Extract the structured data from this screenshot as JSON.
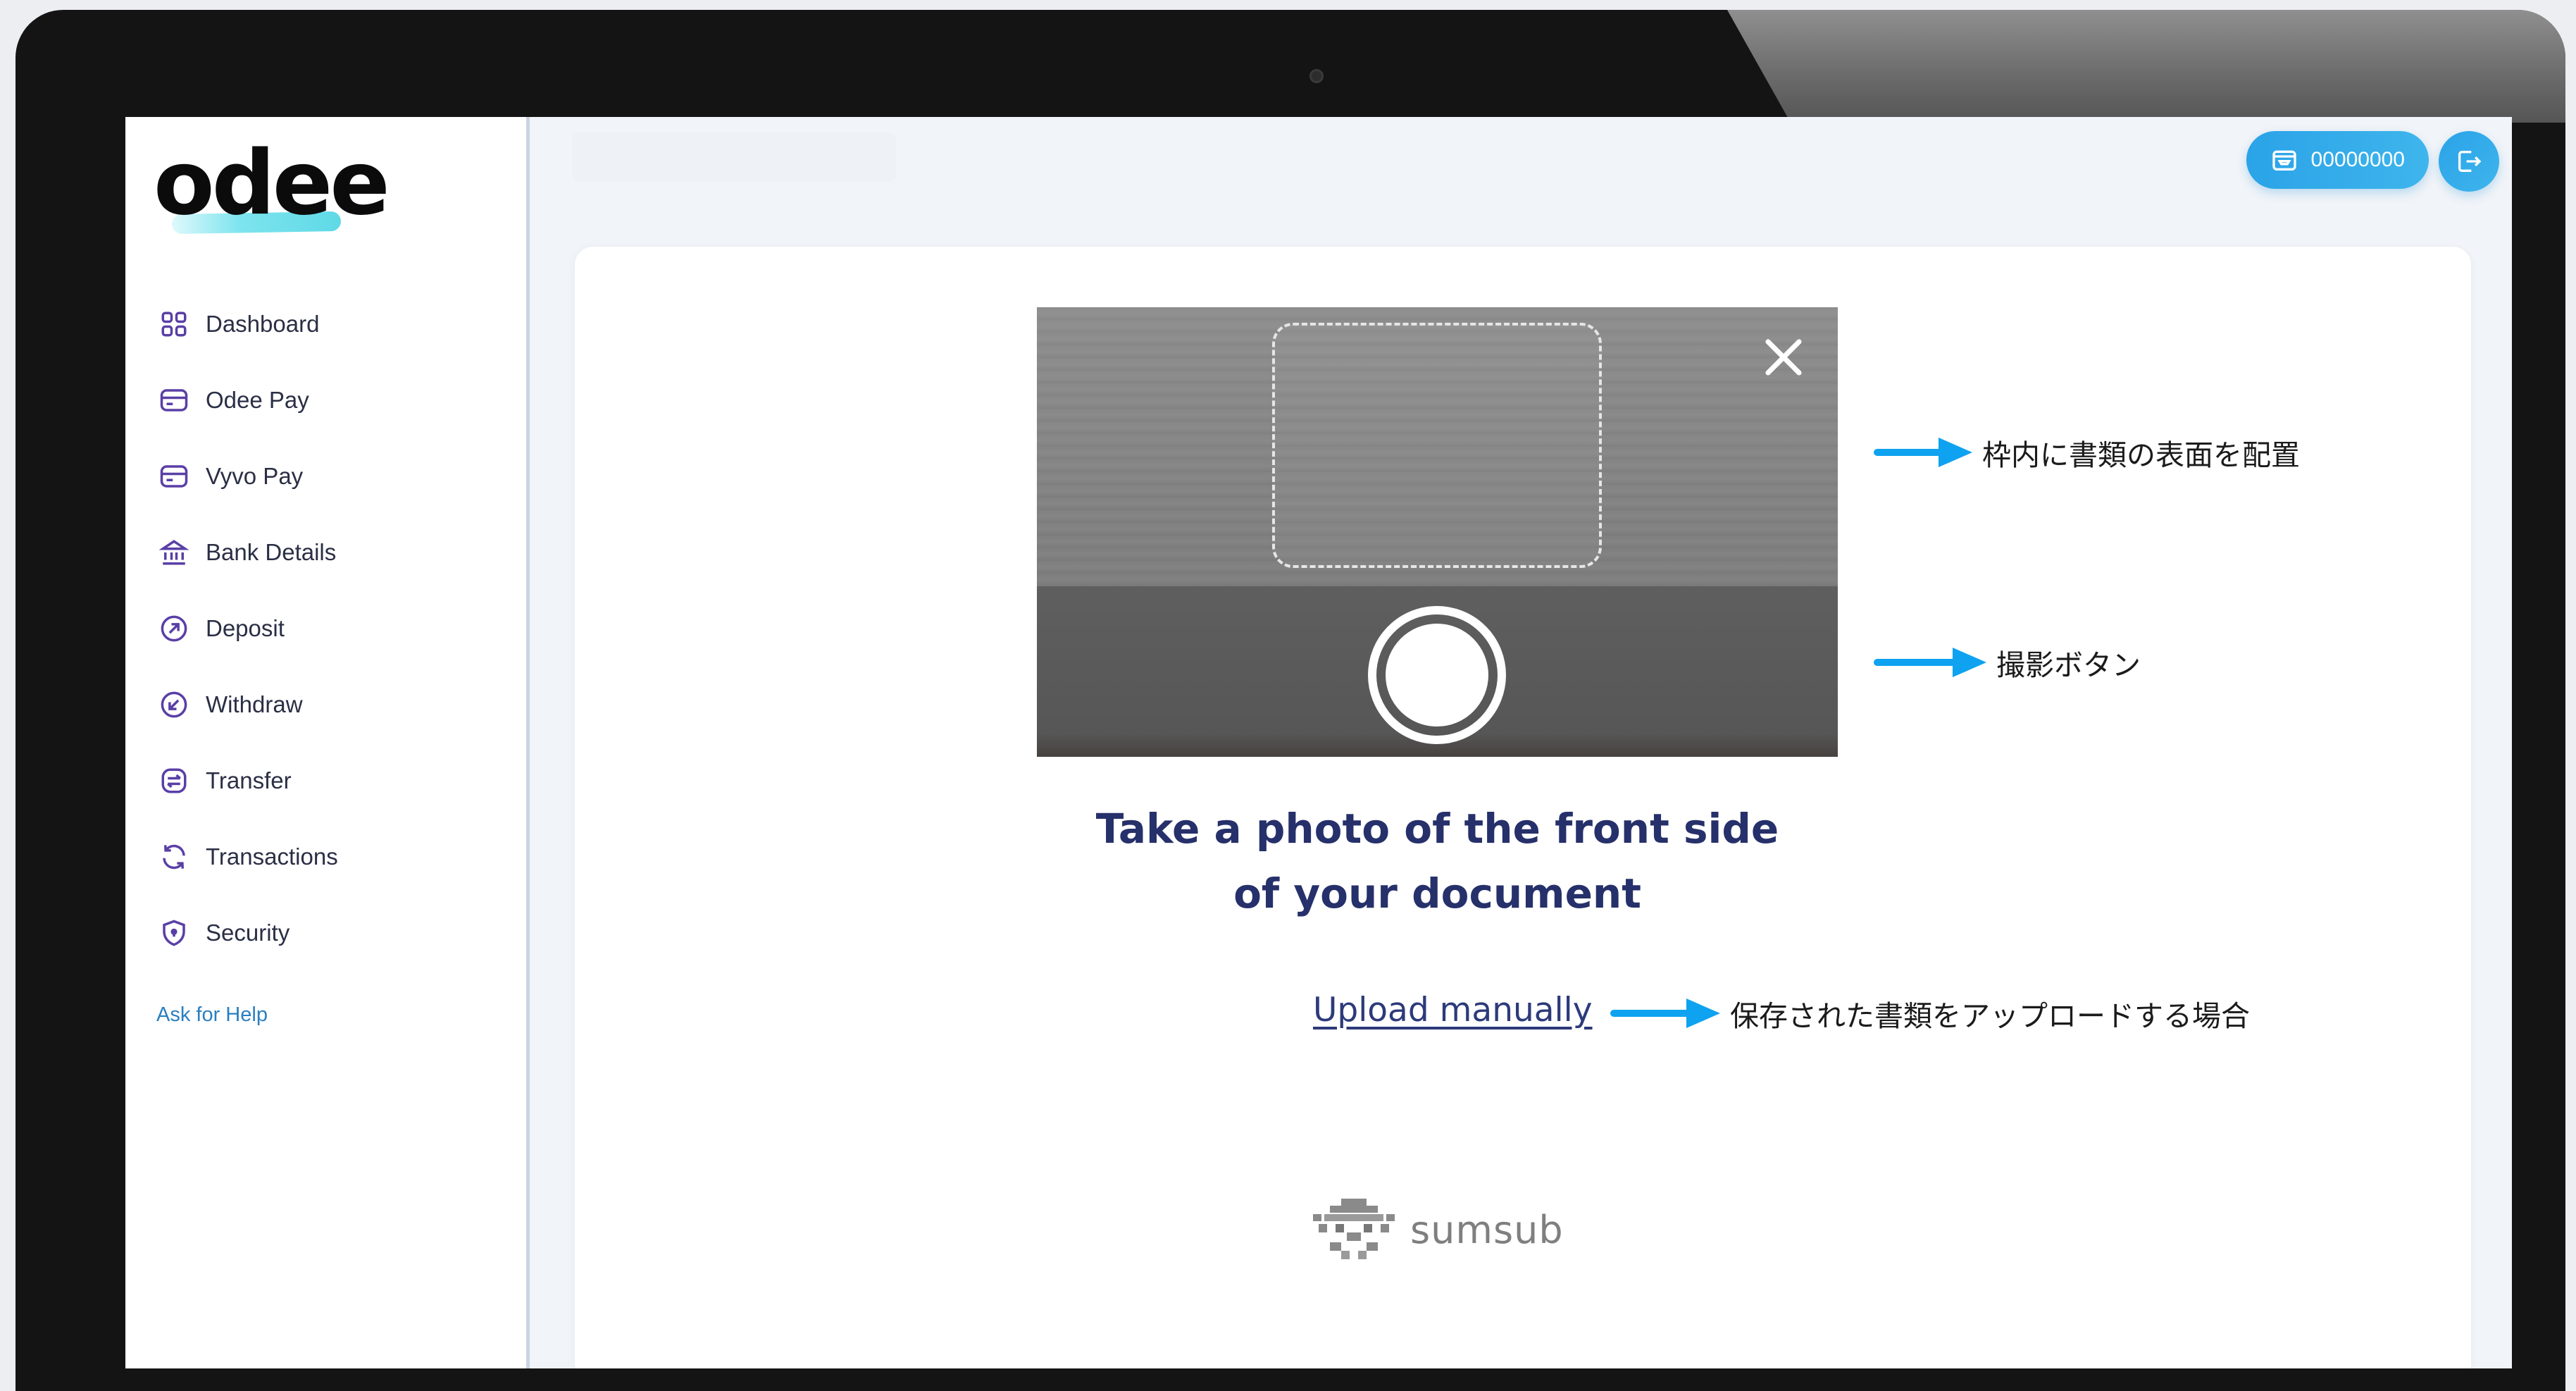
{
  "app": {
    "logo_text": "odee"
  },
  "sidebar": {
    "items": [
      {
        "label": "Dashboard",
        "icon": "dashboard-grid-icon"
      },
      {
        "label": "Odee Pay",
        "icon": "card-icon"
      },
      {
        "label": "Vyvo Pay",
        "icon": "card-icon"
      },
      {
        "label": "Bank Details",
        "icon": "bank-icon"
      },
      {
        "label": "Deposit",
        "icon": "arrow-up-right-circle-icon"
      },
      {
        "label": "Withdraw",
        "icon": "arrow-down-left-circle-icon"
      },
      {
        "label": "Transfer",
        "icon": "transfer-icon"
      },
      {
        "label": "Transactions",
        "icon": "refresh-icon"
      },
      {
        "label": "Security",
        "icon": "shield-icon"
      }
    ],
    "help_label": "Ask for Help"
  },
  "header": {
    "account_number": "00000000",
    "account_icon": "wallet-icon",
    "logout_icon": "logout-icon"
  },
  "verification": {
    "title_line1": "Take a photo of the front side",
    "title_line2": "of your document",
    "upload_label": "Upload manually",
    "provider_name": "sumsub"
  },
  "annotations": {
    "frame_note": "枠内に書類の表面を配置",
    "shutter_note": "撮影ボタン",
    "upload_note": "保存された書類をアップロードする場合"
  },
  "colors": {
    "accent": "#2aa3e8",
    "title": "#26306a",
    "arrow": "#0ea2f0",
    "link": "#2a7fc0"
  }
}
